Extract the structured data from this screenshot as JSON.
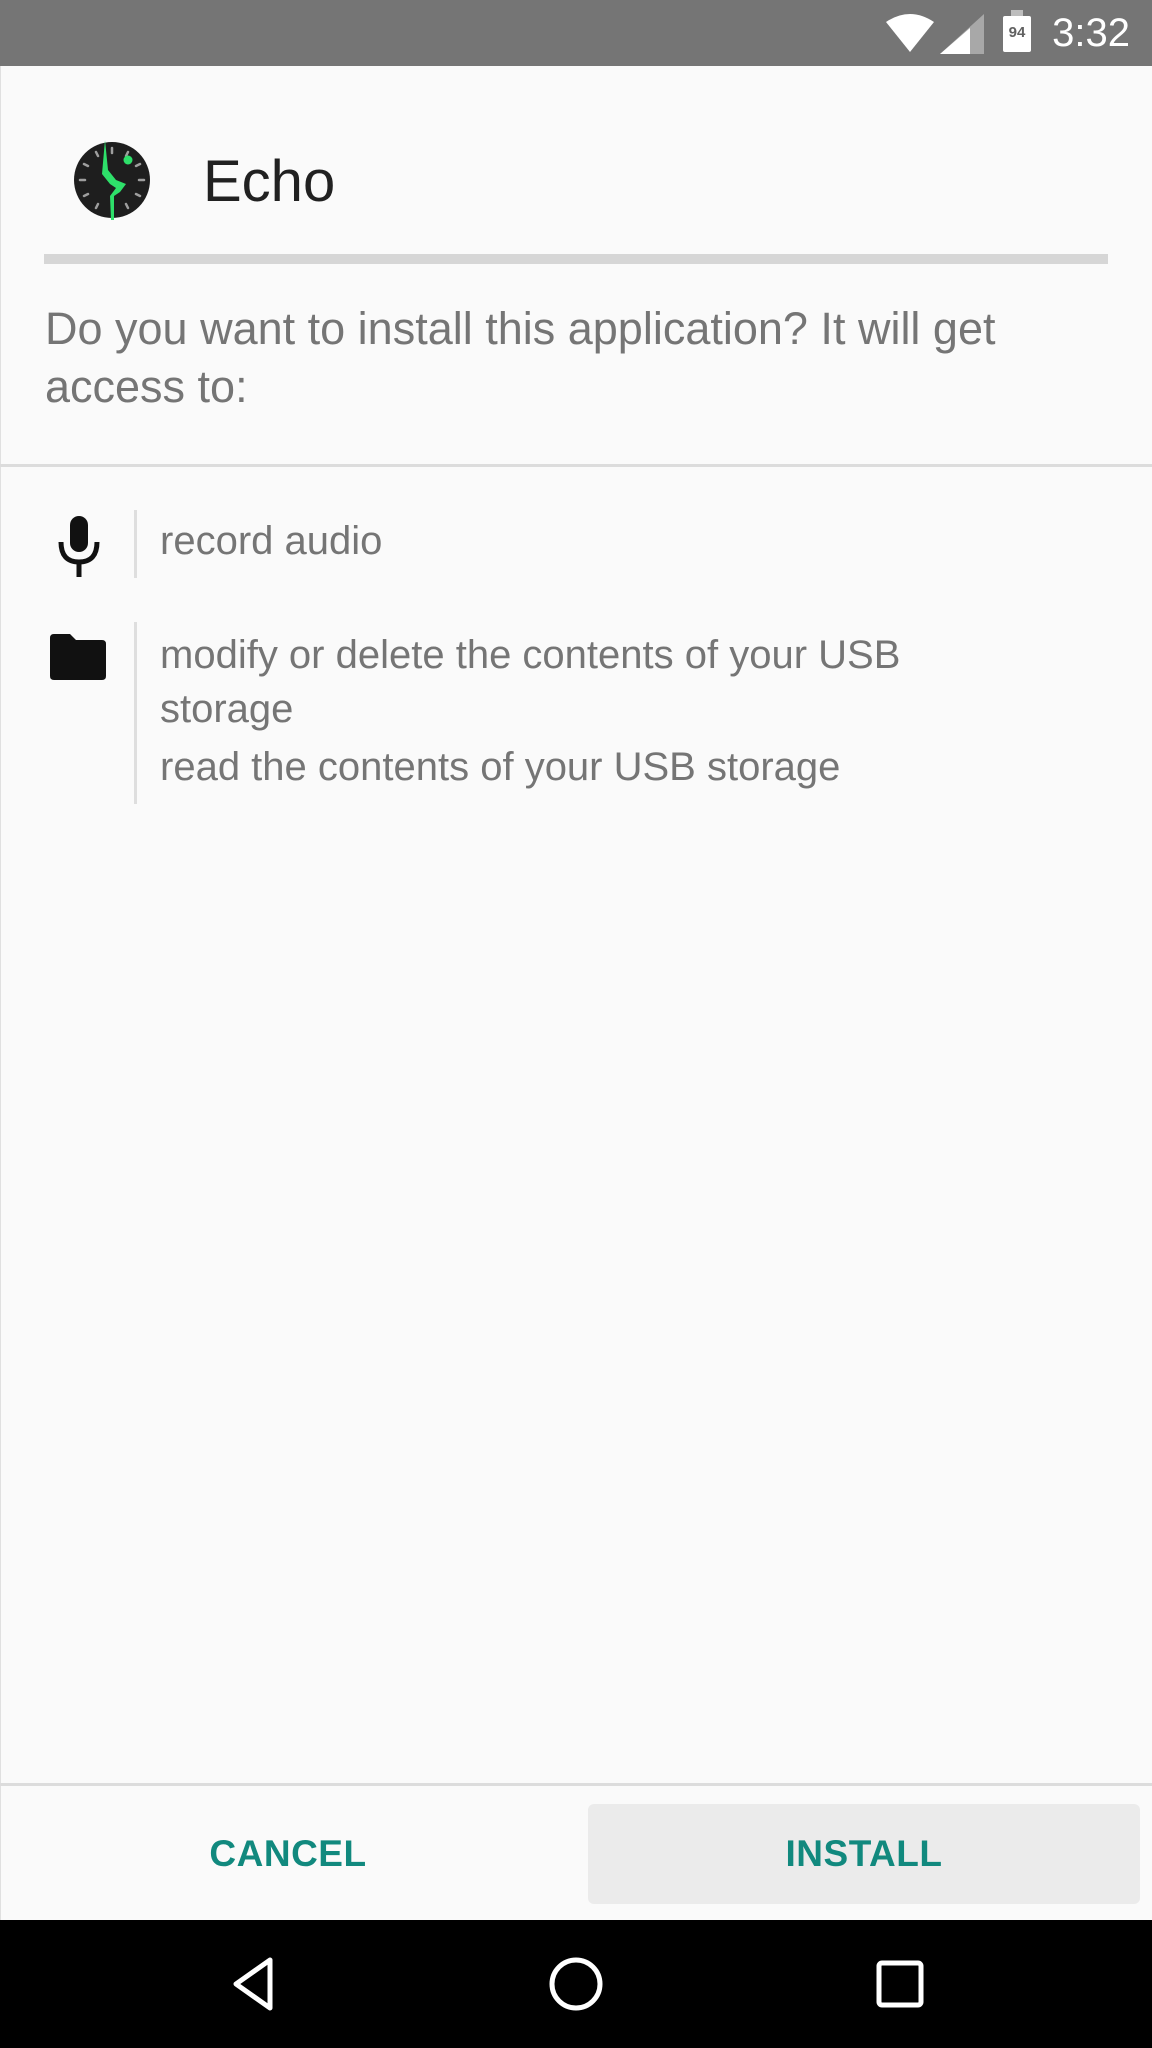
{
  "status_bar": {
    "time": "3:32",
    "battery_level": "94",
    "icons": [
      "wifi-icon",
      "cell-signal-icon",
      "battery-icon"
    ]
  },
  "app": {
    "name": "Echo",
    "icon": "echo-app-icon"
  },
  "prompt": {
    "question": "Do you want to install this application? It will get access to:"
  },
  "permissions": [
    {
      "icon": "microphone-icon",
      "items": [
        "record audio"
      ]
    },
    {
      "icon": "folder-icon",
      "items": [
        "modify or delete the contents of your USB storage",
        "read the contents of your USB storage"
      ]
    }
  ],
  "buttons": {
    "cancel": "CANCEL",
    "install": "INSTALL"
  },
  "colors": {
    "accent": "#11897e",
    "status_bar": "#757575",
    "nav_bar": "#000000",
    "app_icon_green": "#2ee06a"
  },
  "nav_bar": {
    "items": [
      "back-icon",
      "home-icon",
      "recents-icon"
    ]
  }
}
